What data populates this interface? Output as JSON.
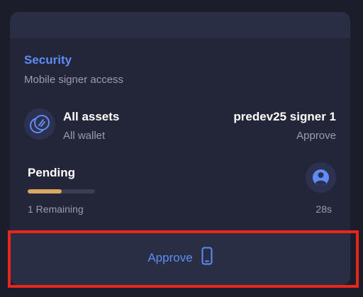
{
  "card": {
    "title": "Security",
    "subtitle": "Mobile signer access"
  },
  "asset": {
    "name": "All assets",
    "scope": "All wallet",
    "icon": "assets-coins-icon"
  },
  "signer": {
    "name": "predev25 signer 1",
    "action": "Approve"
  },
  "pending": {
    "label": "Pending",
    "progress_fraction": 0.5,
    "remaining": "1 Remaining",
    "timer": "28s",
    "avatar_icon": "user-avatar-icon"
  },
  "approve_button": {
    "label": "Approve",
    "icon": "mobile-phone-icon"
  },
  "colors": {
    "accent": "#5f8cf5",
    "progress": "#d9a862",
    "highlight": "#e8261b",
    "background": "#1b1d2b",
    "card": "#232639"
  }
}
